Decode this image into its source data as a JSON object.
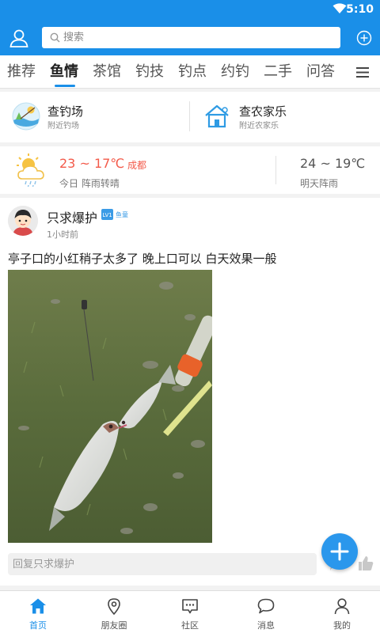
{
  "status_bar": {
    "time": "5:10",
    "icon": "wifi-icon"
  },
  "header": {
    "search_placeholder": "搜索",
    "colors": {
      "brand": "#1a8fe8"
    }
  },
  "tabs": [
    {
      "label": "推荐",
      "active": false
    },
    {
      "label": "鱼情",
      "active": true
    },
    {
      "label": "茶馆",
      "active": false
    },
    {
      "label": "钓技",
      "active": false
    },
    {
      "label": "钓点",
      "active": false
    },
    {
      "label": "约钓",
      "active": false
    },
    {
      "label": "二手",
      "active": false
    },
    {
      "label": "问答",
      "active": false
    }
  ],
  "quick_entries": [
    {
      "title": "查钓场",
      "subtitle": "附近钓场",
      "icon": "fishing-spot-icon"
    },
    {
      "title": "查农家乐",
      "subtitle": "附近农家乐",
      "icon": "farmhouse-icon"
    }
  ],
  "weather": {
    "today_temp": "23 ~ 17℃",
    "city": "成都",
    "today_desc": "今日 阵雨转晴",
    "tomorrow_temp": "24 ~ 19℃",
    "tomorrow_desc": "明天阵雨",
    "icon": "partly-cloudy-rain-icon",
    "colors": {
      "today": "#f35a4a"
    }
  },
  "post": {
    "username": "只求爆护",
    "badge_level": "LV1",
    "badge_title": "鱼童",
    "time": "1小时前",
    "content": "亭子口的小红稍子太多了 晚上口可以  白天效果一般",
    "reply_placeholder": "回复只求爆护"
  },
  "bottom_nav": [
    {
      "label": "首页",
      "icon": "home-icon",
      "active": true
    },
    {
      "label": "朋友圈",
      "icon": "location-pin-icon",
      "active": false
    },
    {
      "label": "社区",
      "icon": "community-chat-icon",
      "active": false
    },
    {
      "label": "消息",
      "icon": "message-bubble-icon",
      "active": false
    },
    {
      "label": "我的",
      "icon": "profile-icon",
      "active": false
    }
  ]
}
